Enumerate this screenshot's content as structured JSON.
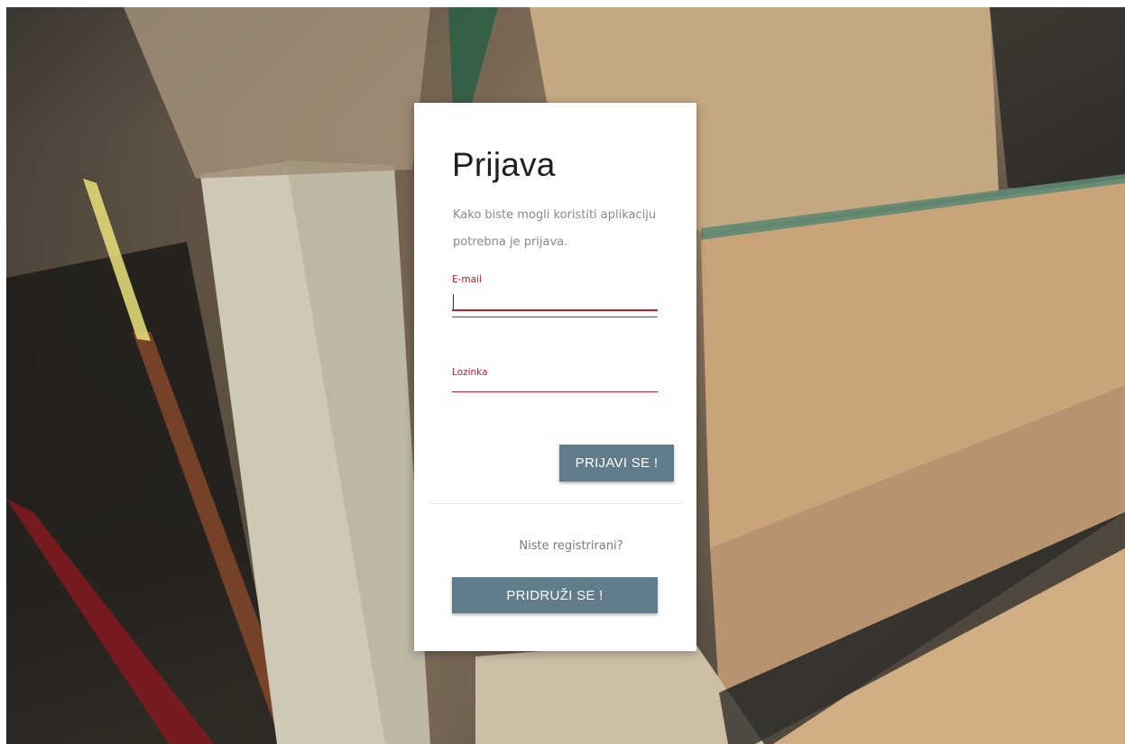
{
  "login": {
    "title": "Prijava",
    "subtitle": "Kako biste mogli koristiti aplikaciju potrebna je prijava.",
    "email_label": "E-mail",
    "email_value": "",
    "password_label": "Lozinka",
    "password_value": "",
    "login_button": "PRIJAVI SE !",
    "register_question": "Niste registrirani?",
    "join_button": "PRIDRUŽI SE !"
  },
  "colors": {
    "accent": "#b8232d",
    "button": "#617c8a",
    "card": "#ffffff"
  }
}
